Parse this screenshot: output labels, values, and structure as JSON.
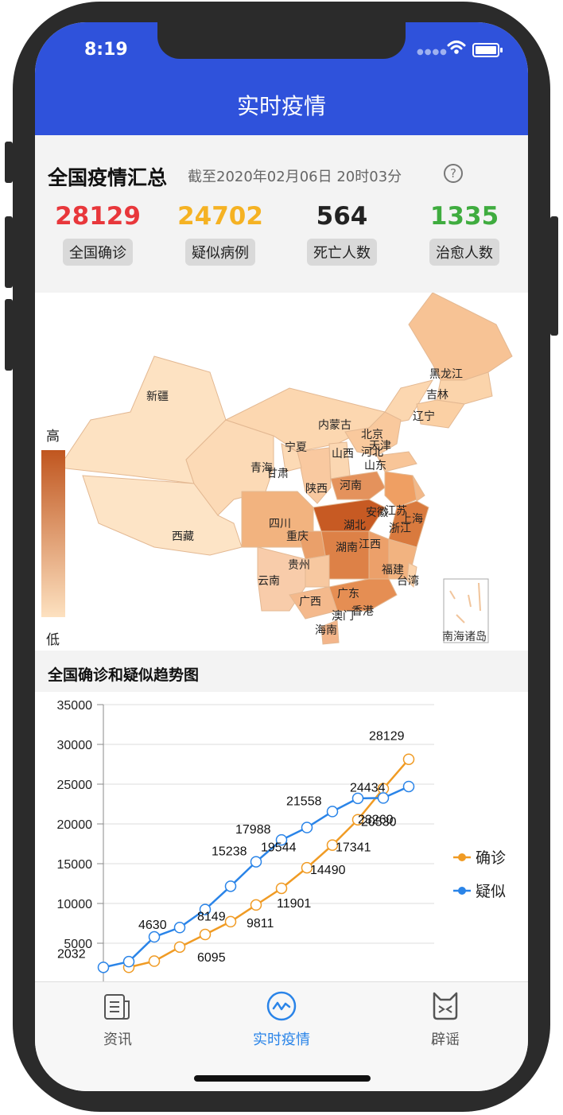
{
  "status_bar": {
    "time": "8:19"
  },
  "nav": {
    "title": "实时疫情"
  },
  "summary": {
    "title": "全国疫情汇总",
    "updated": "截至2020年02月06日 20时03分",
    "help_icon": "question-circle-icon",
    "stats": [
      {
        "value": "28129",
        "label": "全国确诊",
        "color": "#e8373b"
      },
      {
        "value": "24702",
        "label": "疑似病例",
        "color": "#f5b223"
      },
      {
        "value": "564",
        "label": "死亡人数",
        "color": "#222222"
      },
      {
        "value": "1335",
        "label": "治愈人数",
        "color": "#3fac3f"
      }
    ]
  },
  "map": {
    "legend": {
      "high": "高",
      "low": "低"
    },
    "inset_label": "南海诸岛",
    "regions": [
      {
        "name": "新疆",
        "level": 1
      },
      {
        "name": "西藏",
        "level": 0
      },
      {
        "name": "青海",
        "level": 1
      },
      {
        "name": "甘肃",
        "level": 1
      },
      {
        "name": "内蒙古",
        "level": 1
      },
      {
        "name": "黑龙江",
        "level": 2
      },
      {
        "name": "吉林",
        "level": 1
      },
      {
        "name": "辽宁",
        "level": 1
      },
      {
        "name": "北京",
        "level": 2
      },
      {
        "name": "天津",
        "level": 1
      },
      {
        "name": "河北",
        "level": 2
      },
      {
        "name": "山西",
        "level": 1
      },
      {
        "name": "山东",
        "level": 2
      },
      {
        "name": "宁夏",
        "level": 1
      },
      {
        "name": "陕西",
        "level": 2
      },
      {
        "name": "河南",
        "level": 4
      },
      {
        "name": "江苏",
        "level": 3
      },
      {
        "name": "安徽",
        "level": 3
      },
      {
        "name": "上海",
        "level": 2
      },
      {
        "name": "浙江",
        "level": 4
      },
      {
        "name": "湖北",
        "level": 6
      },
      {
        "name": "四川",
        "level": 2
      },
      {
        "name": "重庆",
        "level": 3
      },
      {
        "name": "湖南",
        "level": 4
      },
      {
        "name": "江西",
        "level": 3
      },
      {
        "name": "贵州",
        "level": 1
      },
      {
        "name": "云南",
        "level": 1
      },
      {
        "name": "福建",
        "level": 2
      },
      {
        "name": "台湾",
        "level": 1
      },
      {
        "name": "广西",
        "level": 2
      },
      {
        "name": "广东",
        "level": 4
      },
      {
        "name": "香港",
        "level": 1
      },
      {
        "name": "澳门",
        "level": 1
      },
      {
        "name": "海南",
        "level": 2
      }
    ]
  },
  "trend": {
    "title": "全国确诊和疑似趋势图"
  },
  "chart_data": {
    "type": "line",
    "title": "全国确诊和疑似趋势图",
    "ylim": [
      0,
      35000
    ],
    "yticks": [
      5000,
      10000,
      15000,
      20000,
      25000,
      30000,
      35000
    ],
    "x": [
      1,
      2,
      3,
      4,
      5,
      6,
      7,
      8,
      9,
      10,
      11,
      12,
      13,
      14
    ],
    "series": [
      {
        "name": "确诊",
        "color": "#f09b24",
        "values": [
          1975,
          2744,
          4515,
          6095,
          7711,
          9811,
          11901,
          14490,
          17341,
          20530,
          24434,
          28129
        ]
      },
      {
        "name": "疑似",
        "color": "#2a84e8",
        "values": [
          1965,
          2684,
          5794,
          6973,
          9239,
          12167,
          15238,
          17988,
          19544,
          21558,
          23214,
          23260,
          24702
        ]
      }
    ],
    "labels": {
      "确诊": [
        "",
        "",
        "",
        "6095",
        "",
        "9811",
        "11901",
        "14490",
        "17341",
        "20530",
        "24434",
        "28129"
      ],
      "疑似": [
        "2032",
        "",
        "4630",
        "",
        "8149",
        "",
        "15238",
        "17988",
        "19544",
        "21558",
        "",
        "23260",
        ""
      ]
    },
    "legend_position": "right"
  },
  "tabbar": {
    "items": [
      {
        "label": "资讯",
        "icon": "news-icon",
        "active": false
      },
      {
        "label": "实时疫情",
        "icon": "trend-icon",
        "active": true
      },
      {
        "label": "辟谣",
        "icon": "rumor-icon",
        "active": false
      }
    ],
    "active_color": "#2a84e8",
    "inactive_color": "#555555"
  }
}
